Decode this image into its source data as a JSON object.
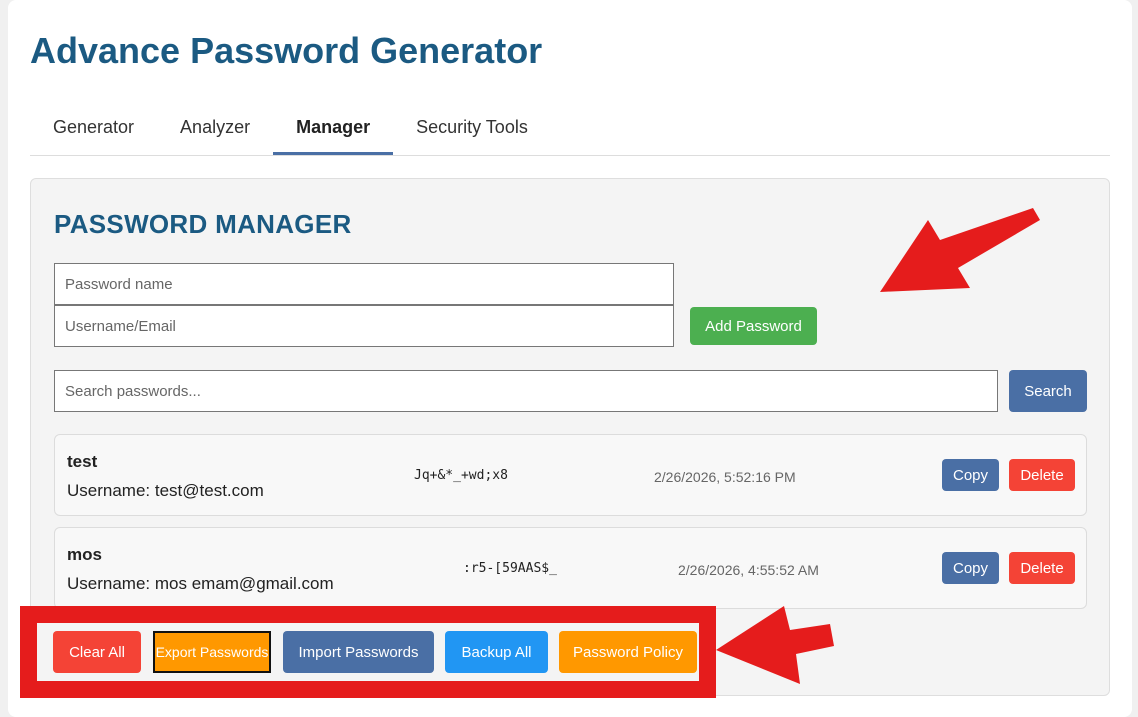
{
  "app": {
    "title": "Advance Password Generator"
  },
  "tabs": [
    {
      "label": "Generator",
      "active": false
    },
    {
      "label": "Analyzer",
      "active": false
    },
    {
      "label": "Manager",
      "active": true
    },
    {
      "label": "Security Tools",
      "active": false
    }
  ],
  "manager": {
    "title": "PASSWORD MANAGER",
    "name_placeholder": "Password name",
    "username_placeholder": "Username/Email",
    "add_label": "Add Password",
    "search_placeholder": "Search passwords...",
    "search_label": "Search"
  },
  "entries": [
    {
      "name": "test",
      "username": "Username: test@test.com",
      "password": "Jq+&*_+wd;x8",
      "date": "2/26/2026, 5:52:16 PM",
      "copy_label": "Copy",
      "delete_label": "Delete"
    },
    {
      "name": "mos",
      "username": "Username: mos emam@gmail.com",
      "password": ":r5-[59AAS$_",
      "date": "2/26/2026, 4:55:52 AM",
      "copy_label": "Copy",
      "delete_label": "Delete"
    }
  ],
  "actions": {
    "clear_all": "Clear All",
    "export": "Export Passwords",
    "import": "Import Passwords",
    "backup": "Backup All",
    "policy": "Password Policy"
  },
  "colors": {
    "title": "#1b5a82",
    "green": "#4caf50",
    "blue": "#4a6fa5",
    "red": "#f44336",
    "orange": "#ff9800",
    "sky_blue": "#2196f3",
    "annotation_red": "#e51c1c"
  },
  "annotations": [
    "arrow-icon",
    "arrow-icon"
  ]
}
